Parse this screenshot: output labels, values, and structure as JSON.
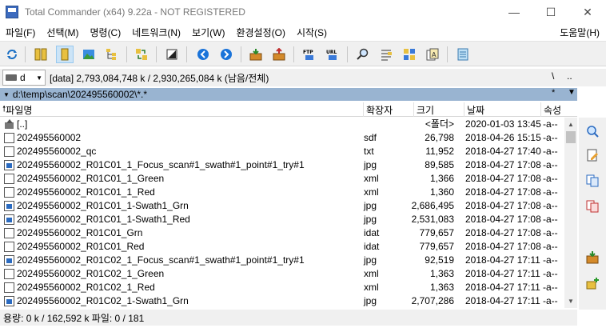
{
  "window": {
    "title": "Total Commander (x64) 9.22a - NOT REGISTERED",
    "minimize_glyph": "—",
    "maximize_glyph": "☐",
    "close_glyph": "✕"
  },
  "menu": {
    "items": [
      "파일(F)",
      "선택(M)",
      "명령(C)",
      "네트워크(N)",
      "보기(W)",
      "환경설정(O)",
      "시작(S)"
    ],
    "help": "도움말(H)"
  },
  "toolbar": {
    "buttons": [
      "refresh-icon",
      "brief-view-icon",
      "full-view-icon",
      "thumbnails-icon",
      "tree-icon",
      "sync-dirs-icon",
      "invert-selection-icon",
      "back-icon",
      "forward-icon",
      "pack-icon",
      "unpack-icon",
      "ftp-icon",
      "url-icon",
      "find-icon",
      "multi-rename-icon",
      "compare-dirs-icon",
      "compare-files-icon",
      "notepad-icon"
    ]
  },
  "drive": {
    "letter": "d",
    "info": "[data]  2,793,084,748 k / 2,930,265,084 k (남음/전체)",
    "root": "\\",
    "up": ".."
  },
  "path": {
    "text": "d:\\temp\\scan\\202495560002\\*.*",
    "history": "*",
    "favorites": "▼"
  },
  "columns": {
    "name": "파일명",
    "ext": "확장자",
    "size": "크기",
    "date": "날짜",
    "attr": "속성"
  },
  "files": [
    {
      "icon": "up-dir-icon",
      "name": "[..]",
      "ext": "",
      "size": "<폴더>",
      "date": "2020-01-03 13:45",
      "attr": "-a--"
    },
    {
      "icon": "doc-icon",
      "name": "202495560002",
      "ext": "sdf",
      "size": "26,798",
      "date": "2018-04-26 15:15",
      "attr": "-a--"
    },
    {
      "icon": "doc-icon",
      "name": "202495560002_qc",
      "ext": "txt",
      "size": "11,952",
      "date": "2018-04-27 17:40",
      "attr": "-a--"
    },
    {
      "icon": "image-icon",
      "name": "202495560002_R01C01_1_Focus_scan#1_swath#1_point#1_try#1",
      "ext": "jpg",
      "size": "89,585",
      "date": "2018-04-27 17:08",
      "attr": "-a--"
    },
    {
      "icon": "doc-icon",
      "name": "202495560002_R01C01_1_Green",
      "ext": "xml",
      "size": "1,366",
      "date": "2018-04-27 17:08",
      "attr": "-a--"
    },
    {
      "icon": "doc-icon",
      "name": "202495560002_R01C01_1_Red",
      "ext": "xml",
      "size": "1,360",
      "date": "2018-04-27 17:08",
      "attr": "-a--"
    },
    {
      "icon": "image-icon",
      "name": "202495560002_R01C01_1-Swath1_Grn",
      "ext": "jpg",
      "size": "2,686,495",
      "date": "2018-04-27 17:08",
      "attr": "-a--"
    },
    {
      "icon": "image-icon",
      "name": "202495560002_R01C01_1-Swath1_Red",
      "ext": "jpg",
      "size": "2,531,083",
      "date": "2018-04-27 17:08",
      "attr": "-a--"
    },
    {
      "icon": "doc-icon",
      "name": "202495560002_R01C01_Grn",
      "ext": "idat",
      "size": "779,657",
      "date": "2018-04-27 17:08",
      "attr": "-a--"
    },
    {
      "icon": "doc-icon",
      "name": "202495560002_R01C01_Red",
      "ext": "idat",
      "size": "779,657",
      "date": "2018-04-27 17:08",
      "attr": "-a--"
    },
    {
      "icon": "image-icon",
      "name": "202495560002_R01C02_1_Focus_scan#1_swath#1_point#1_try#1",
      "ext": "jpg",
      "size": "92,519",
      "date": "2018-04-27 17:11",
      "attr": "-a--"
    },
    {
      "icon": "doc-icon",
      "name": "202495560002_R01C02_1_Green",
      "ext": "xml",
      "size": "1,363",
      "date": "2018-04-27 17:11",
      "attr": "-a--"
    },
    {
      "icon": "doc-icon",
      "name": "202495560002_R01C02_1_Red",
      "ext": "xml",
      "size": "1,363",
      "date": "2018-04-27 17:11",
      "attr": "-a--"
    },
    {
      "icon": "image-icon",
      "name": "202495560002_R01C02_1-Swath1_Grn",
      "ext": "jpg",
      "size": "2,707,286",
      "date": "2018-04-27 17:11",
      "attr": "-a--"
    }
  ],
  "status": {
    "text": "용량: 0 k / 162,592 k      파일: 0 / 181"
  },
  "right_toolbar": {
    "buttons": [
      "view-icon",
      "edit-icon",
      "copy-icon",
      "move-icon",
      "new-folder-icon",
      "delete-icon"
    ]
  },
  "colors": {
    "path_bar": "#99b4d1",
    "selection_button": "#cce4f7",
    "toolbar_bg": "#f0f0f0"
  }
}
